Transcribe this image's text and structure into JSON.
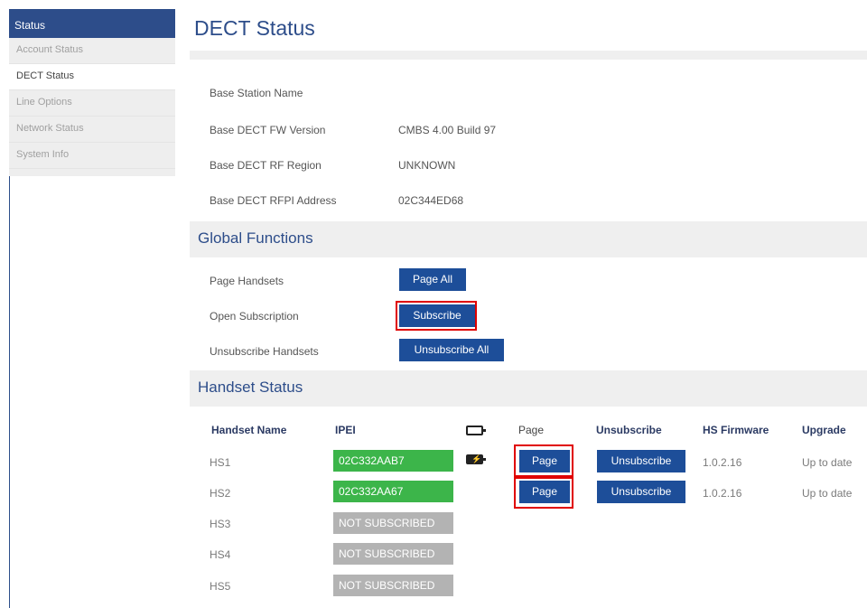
{
  "sidebar": {
    "header": "Status",
    "items": [
      "Account Status",
      "DECT Status",
      "Line Options",
      "Network Status",
      "System Info"
    ]
  },
  "page": {
    "title": "DECT Status"
  },
  "base_info": [
    {
      "label": "Base Station Name",
      "value": ""
    },
    {
      "label": "Base DECT FW Version",
      "value": "CMBS 4.00 Build 97"
    },
    {
      "label": "Base DECT RF Region",
      "value": "UNKNOWN"
    },
    {
      "label": "Base DECT RFPI Address",
      "value": "02C344ED68"
    }
  ],
  "global": {
    "title": "Global Functions",
    "rows": [
      {
        "label": "Page Handsets",
        "button": "Page All"
      },
      {
        "label": "Open Subscription",
        "button": "Subscribe"
      },
      {
        "label": "Unsubscribe Handsets",
        "button": "Unsubscribe All"
      }
    ]
  },
  "handsets": {
    "title": "Handset Status",
    "headers": [
      "Handset Name",
      "IPEI",
      "Page",
      "Unsubscribe",
      "HS Firmware",
      "Upgrade"
    ],
    "battery_icon": "battery-icon",
    "rows": [
      {
        "name": "HS1",
        "ipei": "02C332AAB7",
        "page": "Page",
        "unsubscribe": "Unsubscribe",
        "firmware": "1.0.2.16",
        "upgrade": "Up to date"
      },
      {
        "name": "HS2",
        "ipei": "02C332AA67",
        "page": "Page",
        "unsubscribe": "Unsubscribe",
        "firmware": "1.0.2.16",
        "upgrade": "Up to date"
      },
      {
        "name": "HS3",
        "ipei": "NOT SUBSCRIBED"
      },
      {
        "name": "HS4",
        "ipei": "NOT SUBSCRIBED"
      },
      {
        "name": "HS5",
        "ipei": "NOT SUBSCRIBED"
      }
    ]
  },
  "colors": {
    "primary": "#2d4d8a",
    "button": "#1d4e99",
    "subscribed": "#3cb54a",
    "not_subscribed": "#b3b3b3",
    "highlight": "#e00000"
  }
}
